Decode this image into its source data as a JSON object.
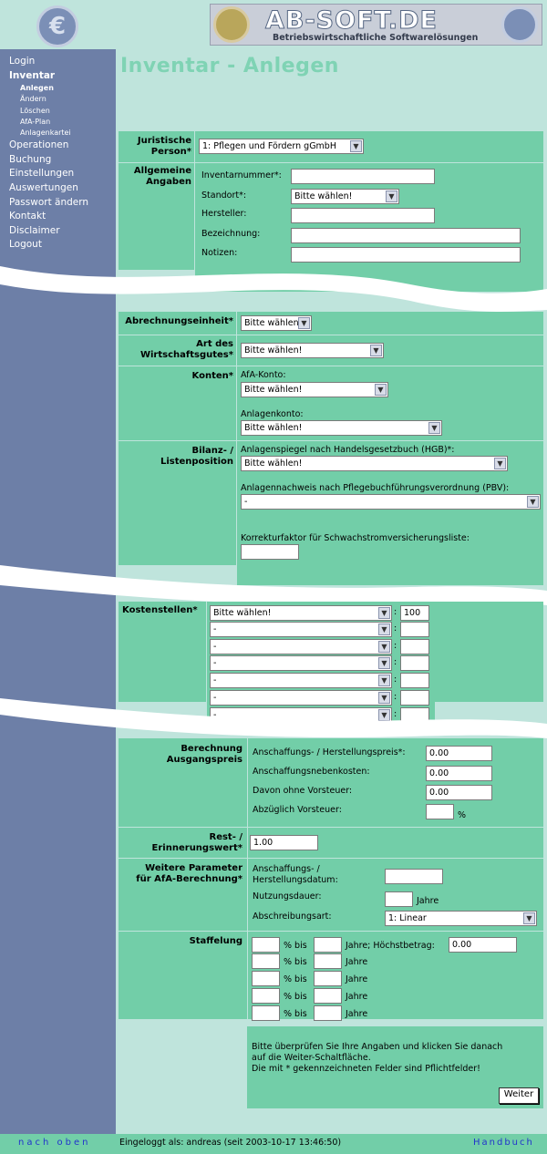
{
  "header": {
    "brand_title": "AB-SOFT.DE",
    "brand_subtitle": "Betriebswirtschaftliche Softwarelösungen",
    "coin_symbol": "€"
  },
  "nav": {
    "items": [
      {
        "label": "Login"
      },
      {
        "label": "Inventar"
      },
      {
        "label": "Operationen"
      },
      {
        "label": "Buchung"
      },
      {
        "label": "Einstellungen"
      },
      {
        "label": "Auswertungen"
      },
      {
        "label": "Passwort ändern"
      },
      {
        "label": "Kontakt"
      },
      {
        "label": "Disclaimer"
      },
      {
        "label": "Logout"
      }
    ],
    "subitems": [
      {
        "label": "Anlegen"
      },
      {
        "label": "Ändern"
      },
      {
        "label": "Löschen"
      },
      {
        "label": "AfA-Plan"
      },
      {
        "label": "Anlagenkartei"
      }
    ]
  },
  "page": {
    "title": "Inventar - Anlegen"
  },
  "form": {
    "juristische_person": {
      "label": "Juristische Person*",
      "value": "1: Pflegen und Fördern gGmbH"
    },
    "allgemeine": {
      "label": "Allgemeine Angaben",
      "inventarnummer": "Inventarnummer*:",
      "standort": "Standort*:",
      "standort_value": "Bitte wählen!",
      "hersteller": "Hersteller:",
      "bezeichnung": "Bezeichnung:",
      "notizen": "Notizen:"
    },
    "abrechnungseinheit": {
      "label": "Abrechnungseinheit*",
      "value": "Bitte wählen!"
    },
    "wirtschaftsgut": {
      "label": "Art des Wirtschaftsgutes*",
      "value": "Bitte wählen!"
    },
    "konten": {
      "label": "Konten*",
      "afa_label": "AfA-Konto:",
      "afa_value": "Bitte wählen!",
      "anlagen_label": "Anlagenkonto:",
      "anlagen_value": "Bitte wählen!"
    },
    "bilanz": {
      "label": "Bilanz- / Listenposition",
      "hgb_label": "Anlagenspiegel nach Handelsgesetzbuch (HGB)*:",
      "hgb_value": "Bitte wählen!",
      "pbv_label": "Anlagennachweis nach Pflegebuchführungsverordnung (PBV):",
      "pbv_value": "-",
      "korrektur_label": "Korrekturfaktor für Schwachstromversicherungsliste:"
    },
    "kostenstellen": {
      "label": "Kostenstellen*",
      "rows": [
        {
          "value": "Bitte wählen!",
          "pct": "100"
        },
        {
          "value": "-",
          "pct": ""
        },
        {
          "value": "-",
          "pct": ""
        },
        {
          "value": "-",
          "pct": ""
        },
        {
          "value": "-",
          "pct": ""
        },
        {
          "value": "-",
          "pct": ""
        },
        {
          "value": "-",
          "pct": ""
        }
      ],
      "separator": ":"
    },
    "berechnung": {
      "label": "Berechnung Ausgangspreis",
      "ahk_label": "Anschaffungs- / Herstellungspreis*:",
      "ahk_value": "0.00",
      "neben_label": "Anschaffungsnebenkosten:",
      "neben_value": "0.00",
      "ohne_vst_label": "Davon ohne Vorsteuer:",
      "ohne_vst_value": "0.00",
      "abz_vst_label": "Abzüglich Vorsteuer:",
      "abz_vst_value": "",
      "pct": "%"
    },
    "rest": {
      "label": "Rest- / Erinnerungswert*",
      "value": "1.00"
    },
    "weitere": {
      "label": "Weitere Parameter für AfA-Berechnung*",
      "datum_label": "Anschaffungs- / Herstellungsdatum:",
      "datum_value": "",
      "dauer_label": "Nutzungsdauer:",
      "jahre": "Jahre",
      "art_label": "Abschreibungsart:",
      "art_value": "1: Linear"
    },
    "staffelung": {
      "label": "Staffelung",
      "pct_bis": "% bis",
      "jahre": "Jahre",
      "jahre_hoechst": "Jahre; Höchstbetrag:",
      "hoechst_value": "0.00"
    },
    "hinweis": {
      "line1": "Bitte überprüfen Sie Ihre Angaben und klicken Sie danach",
      "line2": "auf die Weiter-Schaltfläche.",
      "line3": "Die mit * gekennzeichneten Felder sind Pflichtfelder!",
      "button": "Weiter"
    }
  },
  "footer": {
    "nach_oben": "nach oben",
    "login_info": "Eingeloggt als: andreas (seit 2003-10-17 13:46:50)",
    "handbuch": "Handbuch"
  }
}
